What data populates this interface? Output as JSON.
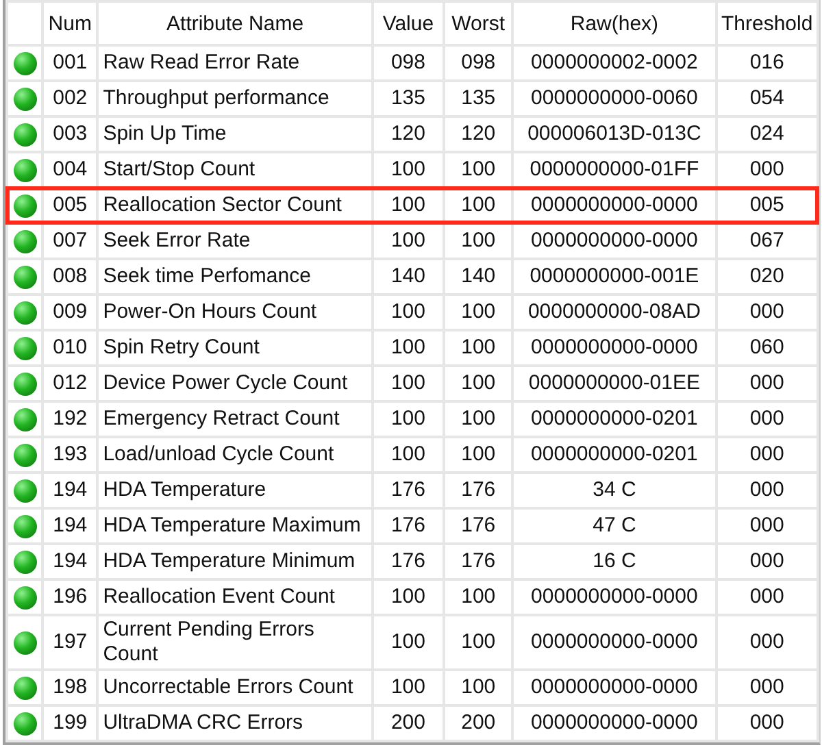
{
  "table": {
    "columns": [
      "Num",
      "Attribute Name",
      "Value",
      "Worst",
      "Raw(hex)",
      "Threshold"
    ],
    "rows": [
      {
        "num": "001",
        "name": "Raw Read Error Rate",
        "value": "098",
        "worst": "098",
        "raw": "0000000002-0002",
        "threshold": "016",
        "highlighted": false
      },
      {
        "num": "002",
        "name": "Throughput performance",
        "value": "135",
        "worst": "135",
        "raw": "0000000000-0060",
        "threshold": "054",
        "highlighted": false
      },
      {
        "num": "003",
        "name": "Spin Up Time",
        "value": "120",
        "worst": "120",
        "raw": "000006013D-013C",
        "threshold": "024",
        "highlighted": false
      },
      {
        "num": "004",
        "name": "Start/Stop Count",
        "value": "100",
        "worst": "100",
        "raw": "0000000000-01FF",
        "threshold": "000",
        "highlighted": false
      },
      {
        "num": "005",
        "name": "Reallocation Sector Count",
        "value": "100",
        "worst": "100",
        "raw": "0000000000-0000",
        "threshold": "005",
        "highlighted": true
      },
      {
        "num": "007",
        "name": "Seek Error Rate",
        "value": "100",
        "worst": "100",
        "raw": "0000000000-0000",
        "threshold": "067",
        "highlighted": false
      },
      {
        "num": "008",
        "name": "Seek time Perfomance",
        "value": "140",
        "worst": "140",
        "raw": "0000000000-001E",
        "threshold": "020",
        "highlighted": false
      },
      {
        "num": "009",
        "name": "Power-On Hours Count",
        "value": "100",
        "worst": "100",
        "raw": "0000000000-08AD",
        "threshold": "000",
        "highlighted": false
      },
      {
        "num": "010",
        "name": "Spin Retry Count",
        "value": "100",
        "worst": "100",
        "raw": "0000000000-0000",
        "threshold": "060",
        "highlighted": false
      },
      {
        "num": "012",
        "name": "Device Power Cycle Count",
        "value": "100",
        "worst": "100",
        "raw": "0000000000-01EE",
        "threshold": "000",
        "highlighted": false
      },
      {
        "num": "192",
        "name": "Emergency Retract Count",
        "value": "100",
        "worst": "100",
        "raw": "0000000000-0201",
        "threshold": "000",
        "highlighted": false
      },
      {
        "num": "193",
        "name": "Load/unload Cycle Count",
        "value": "100",
        "worst": "100",
        "raw": "0000000000-0201",
        "threshold": "000",
        "highlighted": false
      },
      {
        "num": "194",
        "name": "HDA Temperature",
        "value": "176",
        "worst": "176",
        "raw": "34 C",
        "threshold": "000",
        "highlighted": false
      },
      {
        "num": "194",
        "name": "HDA Temperature Maximum",
        "value": "176",
        "worst": "176",
        "raw": "47 C",
        "threshold": "000",
        "highlighted": false
      },
      {
        "num": "194",
        "name": "HDA Temperature Minimum",
        "value": "176",
        "worst": "176",
        "raw": "16 C",
        "threshold": "000",
        "highlighted": false
      },
      {
        "num": "196",
        "name": "Reallocation Event Count",
        "value": "100",
        "worst": "100",
        "raw": "0000000000-0000",
        "threshold": "000",
        "highlighted": false
      },
      {
        "num": "197",
        "name": "Current Pending Errors Count",
        "value": "100",
        "worst": "100",
        "raw": "0000000000-0000",
        "threshold": "000",
        "highlighted": false
      },
      {
        "num": "198",
        "name": "Uncorrectable Errors Count",
        "value": "100",
        "worst": "100",
        "raw": "0000000000-0000",
        "threshold": "000",
        "highlighted": false
      },
      {
        "num": "199",
        "name": "UltraDMA CRC Errors",
        "value": "200",
        "worst": "200",
        "raw": "0000000000-0000",
        "threshold": "000",
        "highlighted": false
      }
    ]
  }
}
